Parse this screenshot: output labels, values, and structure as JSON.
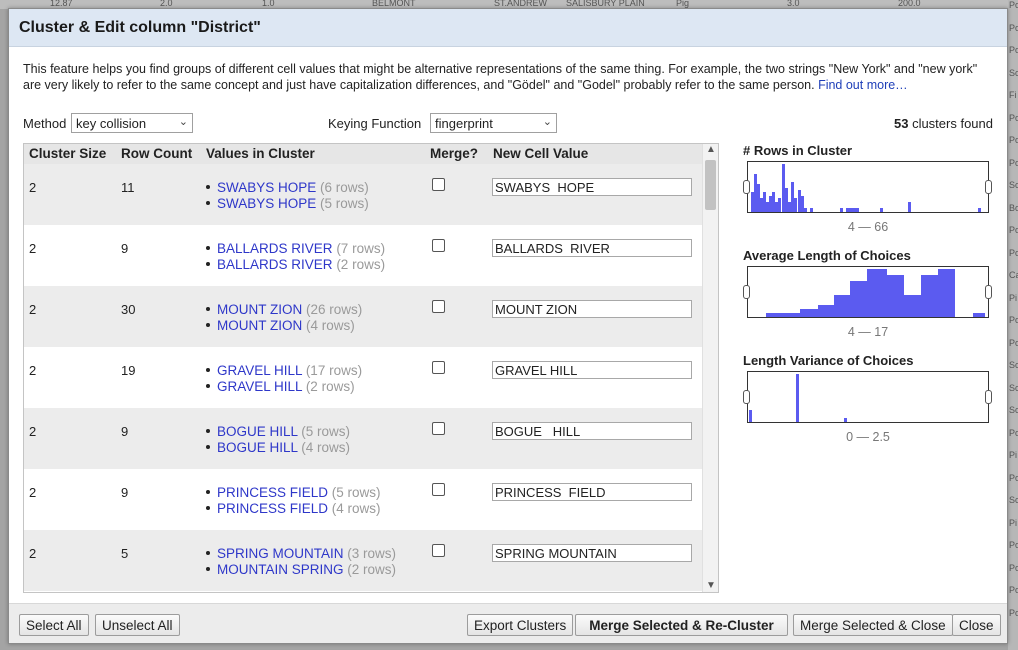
{
  "dialog": {
    "title": "Cluster & Edit column \"District\"",
    "description": "This feature helps you find groups of different cell values that might be alternative representations of the same thing. For example, the two strings \"New York\" and \"new york\" are very likely to refer to the same concept and just have capitalization differences, and \"Gödel\" and \"Godel\" probably refer to the same person.",
    "find_out_more": "Find out more…"
  },
  "controls": {
    "method_label": "Method",
    "method_value": "key collision",
    "keying_label": "Keying Function",
    "keying_value": "fingerprint",
    "clusters_count": "53",
    "clusters_found_label": "clusters found"
  },
  "table": {
    "headers": {
      "cluster_size": "Cluster Size",
      "row_count": "Row Count",
      "values": "Values in Cluster",
      "merge": "Merge?",
      "new_value": "New Cell Value"
    },
    "rows": [
      {
        "size": "2",
        "count": "11",
        "values": [
          {
            "name": "SWABYS HOPE",
            "rows": "(6 rows)"
          },
          {
            "name": "SWABYS HOPE",
            "rows": "(5 rows)"
          }
        ],
        "new_value": "SWABYS  HOPE"
      },
      {
        "size": "2",
        "count": "9",
        "values": [
          {
            "name": "BALLARDS RIVER",
            "rows": "(7 rows)"
          },
          {
            "name": "BALLARDS RIVER",
            "rows": "(2 rows)"
          }
        ],
        "new_value": "BALLARDS  RIVER"
      },
      {
        "size": "2",
        "count": "30",
        "values": [
          {
            "name": "MOUNT ZION",
            "rows": "(26 rows)"
          },
          {
            "name": "MOUNT ZION",
            "rows": "(4 rows)"
          }
        ],
        "new_value": "MOUNT ZION"
      },
      {
        "size": "2",
        "count": "19",
        "values": [
          {
            "name": "GRAVEL HILL",
            "rows": "(17 rows)"
          },
          {
            "name": "GRAVEL HILL",
            "rows": "(2 rows)"
          }
        ],
        "new_value": "GRAVEL HILL"
      },
      {
        "size": "2",
        "count": "9",
        "values": [
          {
            "name": "BOGUE HILL",
            "rows": "(5 rows)"
          },
          {
            "name": "BOGUE HILL",
            "rows": "(4 rows)"
          }
        ],
        "new_value": "BOGUE   HILL"
      },
      {
        "size": "2",
        "count": "9",
        "values": [
          {
            "name": "PRINCESS FIELD",
            "rows": "(5 rows)"
          },
          {
            "name": "PRINCESS FIELD",
            "rows": "(4 rows)"
          }
        ],
        "new_value": "PRINCESS  FIELD"
      },
      {
        "size": "2",
        "count": "5",
        "values": [
          {
            "name": "SPRING MOUNTAIN",
            "rows": "(3 rows)"
          },
          {
            "name": "MOUNTAIN SPRING",
            "rows": "(2 rows)"
          }
        ],
        "new_value": "SPRING MOUNTAIN"
      }
    ]
  },
  "facets": [
    {
      "title": "# Rows in Cluster",
      "range": "4 — 66"
    },
    {
      "title": "Average Length of Choices",
      "range": "4 — 17"
    },
    {
      "title": "Length Variance of Choices",
      "range": "0 — 2.5"
    }
  ],
  "footer": {
    "select_all": "Select All",
    "unselect_all": "Unselect All",
    "export": "Export Clusters",
    "merge_recluster": "Merge Selected & Re-Cluster",
    "merge_close": "Merge Selected & Close",
    "close": "Close"
  },
  "background": {
    "top_row": [
      "12.87",
      "2.0",
      "1.0",
      "BELMONT",
      "ST.ANDREW",
      "SALISBURY PLAIN",
      "Pig",
      "3.0",
      "200.0"
    ],
    "right_col": [
      "Po",
      "Po",
      "Po",
      "Sc",
      "Fi",
      "Po",
      "Po",
      "Po",
      "Sc",
      "Bo",
      "Po",
      "Po",
      "Ca",
      "Pi",
      "Po",
      "Po",
      "Sc",
      "Sc",
      "Sc",
      "Po",
      "Pi",
      "Po",
      "Sc",
      "Pi",
      "Po",
      "Po",
      "Po",
      "Po"
    ]
  },
  "colors": {
    "histogram": "#5b5bf0",
    "header_bg": "#dde7f3",
    "link": "#2e37c9"
  }
}
